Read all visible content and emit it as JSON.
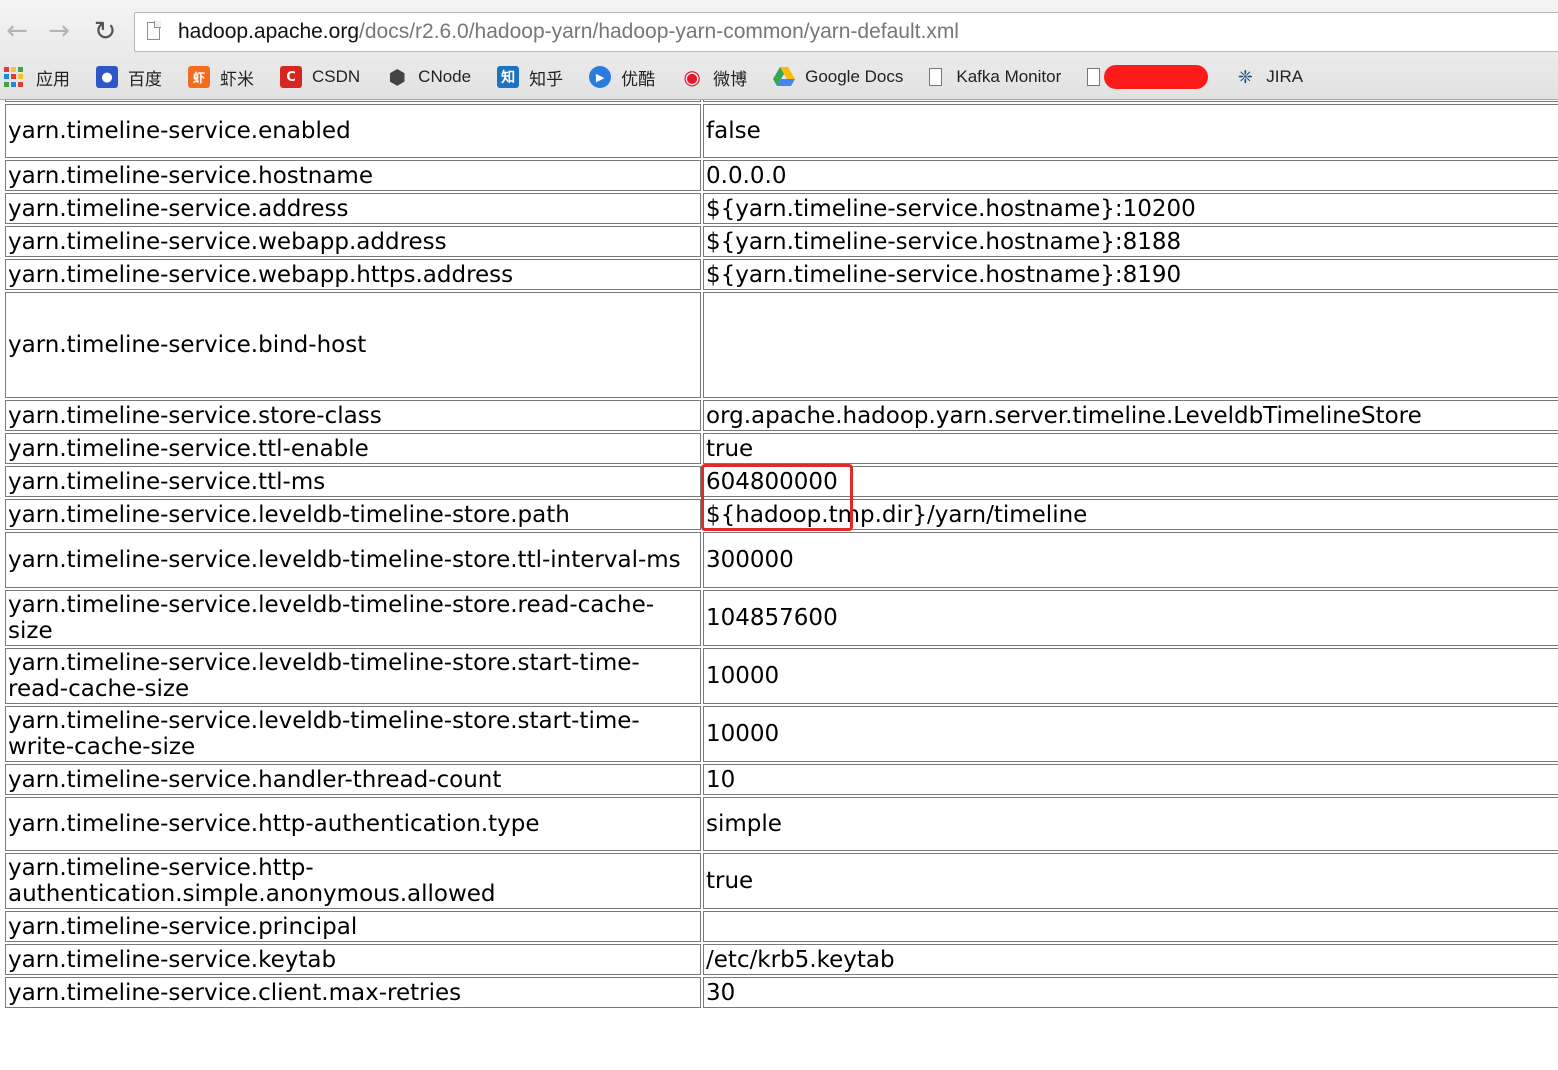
{
  "browser": {
    "url_host": "hadoop.apache.org",
    "url_path": "/docs/r2.6.0/hadoop-yarn/hadoop-yarn-common/yarn-default.xml",
    "bookmarks": [
      {
        "label": "应用",
        "icon": "apps-grid-icon"
      },
      {
        "label": "百度",
        "icon": "baidu-paw-icon",
        "color": "#2d57c7"
      },
      {
        "label": "虾米",
        "icon": "xiami-icon",
        "color": "#f26d1d"
      },
      {
        "label": "CSDN",
        "icon": "csdn-icon",
        "color": "#d7261f"
      },
      {
        "label": "CNode",
        "icon": "cnode-icon",
        "color": "#444444"
      },
      {
        "label": "知乎",
        "icon": "zhihu-icon",
        "color": "#1e73be"
      },
      {
        "label": "优酷",
        "icon": "youku-icon",
        "color": "#2a7be0"
      },
      {
        "label": "微博",
        "icon": "weibo-icon",
        "color": "#e6162d"
      },
      {
        "label": "Google Docs",
        "icon": "google-drive-icon"
      },
      {
        "label": "Kafka Monitor",
        "icon": "document-icon"
      },
      {
        "label": "",
        "icon": "document-icon",
        "redacted": true
      },
      {
        "label": "JIRA",
        "icon": "jira-icon",
        "color": "#205081"
      }
    ]
  },
  "properties": [
    {
      "name": "",
      "value": ""
    },
    {
      "name": "yarn.timeline-service.enabled",
      "value": "false"
    },
    {
      "name": "yarn.timeline-service.hostname",
      "value": "0.0.0.0"
    },
    {
      "name": "yarn.timeline-service.address",
      "value": "${yarn.timeline-service.hostname}:10200"
    },
    {
      "name": "yarn.timeline-service.webapp.address",
      "value": "${yarn.timeline-service.hostname}:8188"
    },
    {
      "name": "yarn.timeline-service.webapp.https.address",
      "value": "${yarn.timeline-service.hostname}:8190"
    },
    {
      "name": "yarn.timeline-service.bind-host",
      "value": ""
    },
    {
      "name": "yarn.timeline-service.store-class",
      "value": "org.apache.hadoop.yarn.server.timeline.LeveldbTimelineStore"
    },
    {
      "name": "yarn.timeline-service.ttl-enable",
      "value": "true",
      "highlighted": true
    },
    {
      "name": "yarn.timeline-service.ttl-ms",
      "value": "604800000",
      "highlighted": true
    },
    {
      "name": "yarn.timeline-service.leveldb-timeline-store.path",
      "value": "${hadoop.tmp.dir}/yarn/timeline"
    },
    {
      "name": "yarn.timeline-service.leveldb-timeline-store.ttl-interval-ms",
      "value": "300000"
    },
    {
      "name": "yarn.timeline-service.leveldb-timeline-store.read-cache-size",
      "value": "104857600"
    },
    {
      "name": "yarn.timeline-service.leveldb-timeline-store.start-time-read-cache-size",
      "value": "10000"
    },
    {
      "name": "yarn.timeline-service.leveldb-timeline-store.start-time-write-cache-size",
      "value": "10000"
    },
    {
      "name": "yarn.timeline-service.handler-thread-count",
      "value": "10"
    },
    {
      "name": "yarn.timeline-service.http-authentication.type",
      "value": "simple"
    },
    {
      "name": "yarn.timeline-service.http-authentication.simple.anonymous.allowed",
      "value": "true"
    },
    {
      "name": "yarn.timeline-service.principal",
      "value": ""
    },
    {
      "name": "yarn.timeline-service.keytab",
      "value": "/etc/krb5.keytab"
    },
    {
      "name": "yarn.timeline-service.client.max-retries",
      "value": "30"
    }
  ],
  "colors": {
    "highlight_box": "#e02a25",
    "redaction": "#ff1a1a"
  }
}
